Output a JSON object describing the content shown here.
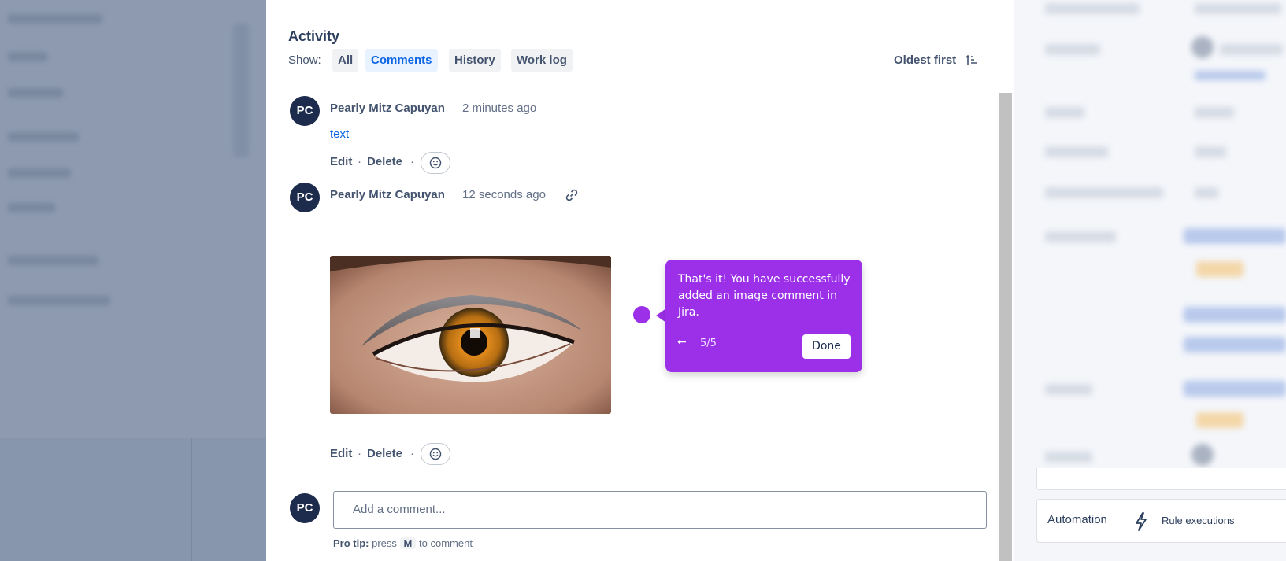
{
  "activity": {
    "heading": "Activity",
    "show_label": "Show:",
    "tabs": [
      {
        "label": "All",
        "active": false
      },
      {
        "label": "Comments",
        "active": true
      },
      {
        "label": "History",
        "active": false
      },
      {
        "label": "Work log",
        "active": false
      }
    ],
    "sort_label": "Oldest first"
  },
  "comments": [
    {
      "avatar_initials": "PC",
      "author": "Pearly Mitz Capuyan",
      "time": "2 minutes ago",
      "text": "text",
      "actions": {
        "edit": "Edit",
        "delete": "Delete",
        "separator": "·"
      }
    },
    {
      "avatar_initials": "PC",
      "author": "Pearly Mitz Capuyan",
      "time": "12 seconds ago",
      "image": "eye-photo",
      "actions": {
        "edit": "Edit",
        "delete": "Delete",
        "separator": "·"
      }
    }
  ],
  "tooltip": {
    "text": "That's it! You have successfully added an image comment in Jira.",
    "back": "←",
    "step": "5/5",
    "done": "Done"
  },
  "composer": {
    "avatar_initials": "PC",
    "placeholder": "Add a comment...",
    "pro_tip_label": "Pro tip:",
    "pro_tip_press": "press",
    "pro_tip_key": "M",
    "pro_tip_suffix": "to comment"
  },
  "side_panel": {
    "automation_label": "Automation",
    "rule_executions_label": "Rule executions"
  },
  "colors": {
    "tooltip_purple": "#9c30e8",
    "link_blue": "#0c66e4",
    "avatar_navy": "#1d2b4d",
    "active_tab_bg": "#e9f2ff"
  }
}
